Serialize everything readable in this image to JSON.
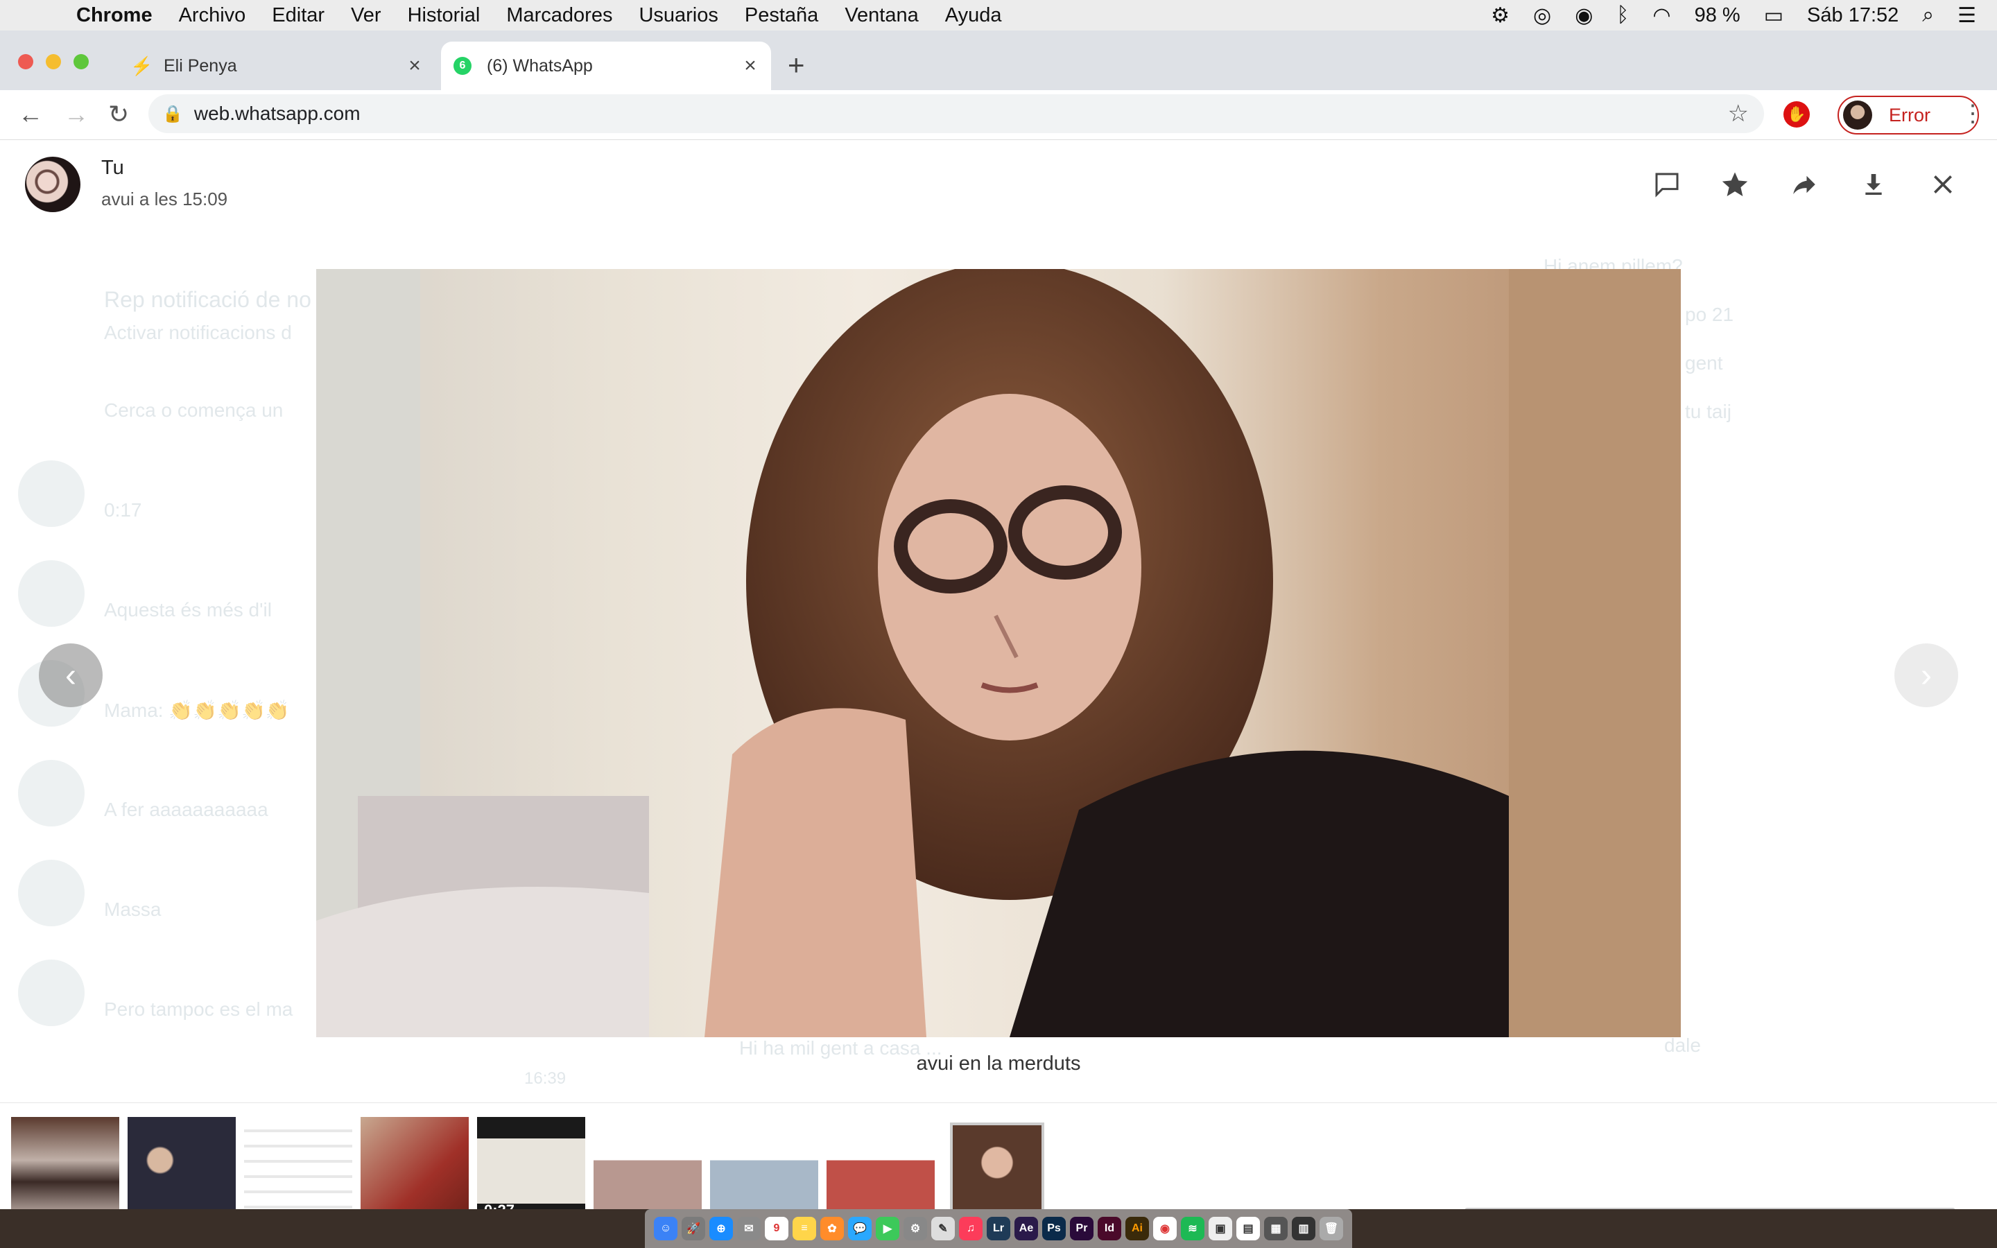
{
  "menubar": {
    "app": "Chrome",
    "items": [
      "Archivo",
      "Editar",
      "Ver",
      "Historial",
      "Marcadores",
      "Usuarios",
      "Pestaña",
      "Ventana",
      "Ayuda"
    ],
    "battery": "98 %",
    "clock": "Sáb 17:52"
  },
  "browser": {
    "tabs": [
      {
        "title": "Eli Penya",
        "active": false
      },
      {
        "title": "(6) WhatsApp",
        "active": true,
        "badge": "6"
      }
    ],
    "url": "web.whatsapp.com",
    "profile_label": "Error"
  },
  "viewer": {
    "sender": "Tu",
    "timestamp": "avui a les 15:09",
    "caption": "avui en la merduts",
    "actions": [
      "reply",
      "star",
      "forward",
      "download",
      "close"
    ],
    "thumbnails": [
      {
        "label": ""
      },
      {
        "label": ""
      },
      {
        "label": ""
      },
      {
        "label": ""
      },
      {
        "label": "0:27",
        "video": true
      },
      {
        "label": ""
      },
      {
        "label": ""
      },
      {
        "label": ""
      },
      {
        "label": "",
        "selected": true
      }
    ]
  },
  "background_chat": {
    "notification_title": "Rep notificació de no",
    "notification_sub": "Activar notificacions d",
    "search_placeholder": "Cerca o comença un",
    "rows": [
      {
        "preview": "0:17",
        "time": ""
      },
      {
        "preview": "Aquesta és més d'il",
        "time": ""
      },
      {
        "preview": "Mama: 👏👏👏👏👏",
        "time": ""
      },
      {
        "preview": "A fer aaaaaaaaaaa",
        "time": ""
      },
      {
        "preview": "Massa",
        "time": ""
      },
      {
        "preview": "Pero tampoc es el ma",
        "time": ""
      },
      {
        "preview": "",
        "time": "16:39"
      }
    ],
    "right_msgs": [
      "Hi anem pillem?",
      "po 21",
      "gent",
      "tu taij"
    ],
    "bottom_msg": "Hi ha mil gent a casa ...",
    "reply_msg": "dale"
  }
}
